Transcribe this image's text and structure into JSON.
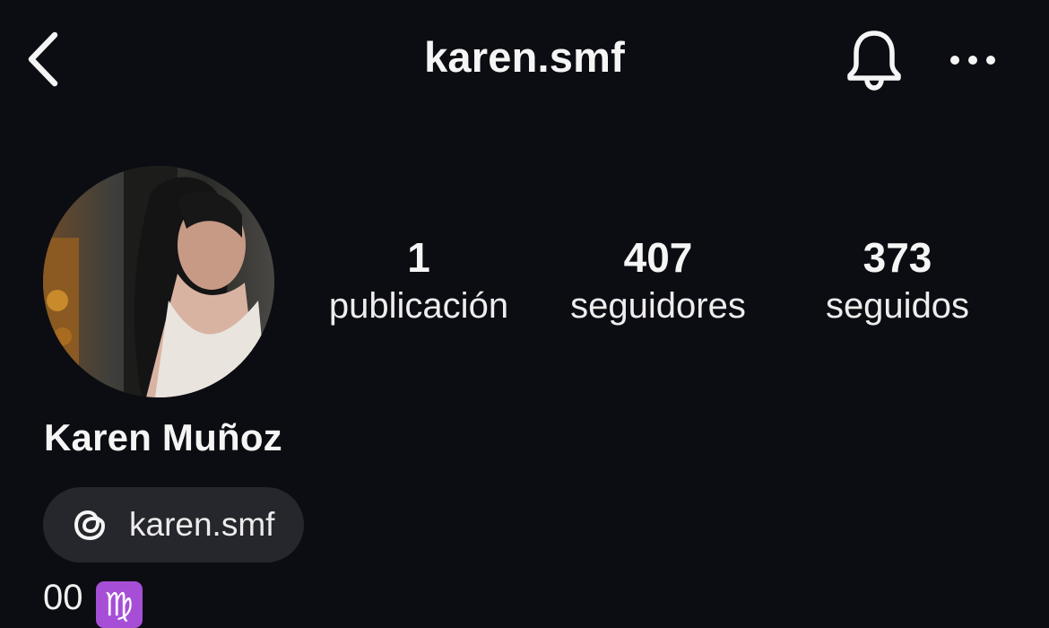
{
  "header": {
    "title": "karen.smf",
    "back_icon": "chevron-left-icon",
    "notifications_icon": "bell-icon",
    "more_icon": "ellipsis-icon"
  },
  "profile": {
    "avatar": "profile-photo",
    "display_name": "Karen Muñoz",
    "stats": [
      {
        "value": "1",
        "label": "publicación"
      },
      {
        "value": "407",
        "label": "seguidores"
      },
      {
        "value": "373",
        "label": "seguidos"
      }
    ],
    "threads": {
      "icon": "threads-icon",
      "handle": "karen.smf"
    },
    "bio": {
      "text": "00",
      "emoji": "♍"
    }
  },
  "colors": {
    "background": "#0c0d12",
    "chip_background": "#26272c",
    "text": "#f5f5f5",
    "emoji_background": "#a64fd6"
  }
}
